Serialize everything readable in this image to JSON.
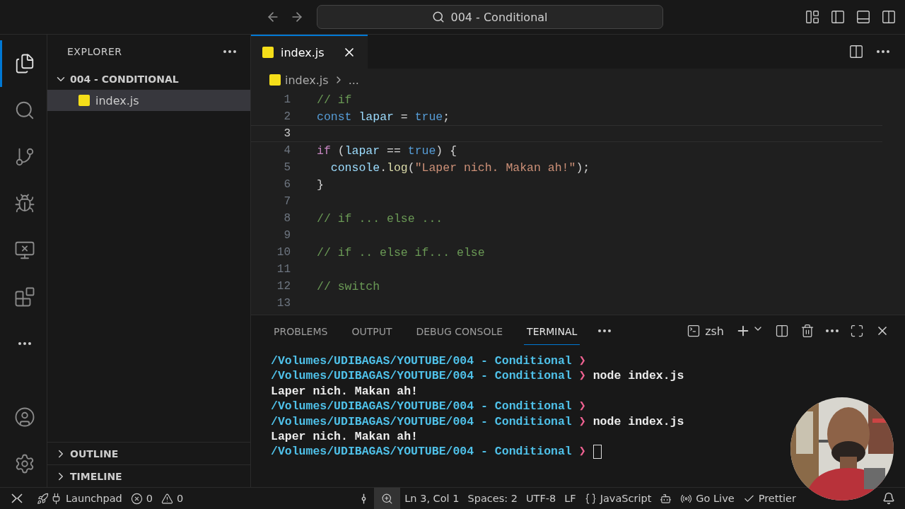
{
  "title_bar": {
    "search": "004 - Conditional"
  },
  "activity_bar": [
    {
      "selected": true
    },
    {
      "selected": false
    },
    {
      "selected": false
    },
    {
      "selected": false
    },
    {
      "selected": false
    },
    {
      "selected": false
    },
    {
      "selected": false
    }
  ],
  "activity_bottom": [
    {
      "selected": false
    },
    {
      "selected": false
    }
  ],
  "sidebar": {
    "title": "EXPLORER",
    "folder": {
      "name": "004 - CONDITIONAL",
      "expanded": true,
      "files": [
        {
          "name": "index.js",
          "selected": true
        }
      ]
    },
    "sections": [
      {
        "name": "OUTLINE",
        "expanded": false
      },
      {
        "name": "TIMELINE",
        "expanded": false
      }
    ]
  },
  "editor": {
    "tabs": [
      {
        "name": "index.js",
        "selected": true
      }
    ],
    "breadcrumb": {
      "file": "index.js",
      "rest": "..."
    },
    "lines": [
      {
        "number": "1",
        "current": false,
        "tokens": [
          {
            "kind": "comment",
            "text": "// if"
          }
        ]
      },
      {
        "number": "2",
        "current": false,
        "tokens": [
          {
            "kind": "keyword",
            "text": "const "
          },
          {
            "kind": "variable",
            "text": "lapar"
          },
          {
            "kind": "punct",
            "text": " = "
          },
          {
            "kind": "keyword",
            "text": "true"
          },
          {
            "kind": "punct",
            "text": ";"
          }
        ]
      },
      {
        "number": "3",
        "current": true
      },
      {
        "number": "4",
        "current": false,
        "tokens": [
          {
            "kind": "control",
            "text": "if "
          },
          {
            "kind": "punct",
            "text": "("
          },
          {
            "kind": "variable",
            "text": "lapar"
          },
          {
            "kind": "punct",
            "text": " == "
          },
          {
            "kind": "keyword",
            "text": "true"
          },
          {
            "kind": "punct",
            "text": ") {"
          }
        ]
      },
      {
        "number": "5",
        "current": false,
        "tokens": [
          {
            "kind": "variable",
            "text": "  console"
          },
          {
            "kind": "punct",
            "text": "."
          },
          {
            "kind": "function",
            "text": "log"
          },
          {
            "kind": "punct",
            "text": "("
          },
          {
            "kind": "string",
            "text": "\"Laper nich. Makan ah!\""
          },
          {
            "kind": "punct",
            "text": ");"
          }
        ]
      },
      {
        "number": "6",
        "current": false,
        "tokens": [
          {
            "kind": "punct",
            "text": "}"
          }
        ]
      },
      {
        "number": "7",
        "current": false
      },
      {
        "number": "8",
        "current": false,
        "tokens": [
          {
            "kind": "comment",
            "text": "// if ... else ..."
          }
        ]
      },
      {
        "number": "9",
        "current": false
      },
      {
        "number": "10",
        "current": false,
        "tokens": [
          {
            "kind": "comment",
            "text": "// if .. else if... else"
          }
        ]
      },
      {
        "number": "11",
        "current": false
      },
      {
        "number": "12",
        "current": false,
        "tokens": [
          {
            "kind": "comment",
            "text": "// switch"
          }
        ]
      },
      {
        "number": "13",
        "current": false
      }
    ]
  },
  "panel": {
    "tabs": [
      {
        "label": "PROBLEMS",
        "selected": false
      },
      {
        "label": "OUTPUT",
        "selected": false
      },
      {
        "label": "DEBUG CONSOLE",
        "selected": false
      },
      {
        "label": "TERMINAL",
        "selected": true
      }
    ],
    "shell": "zsh",
    "lines": [
      {
        "kind": "prompt",
        "path": "/Volumes/UDIBAGAS/YOUTUBE/004 - Conditional",
        "arrow": "❯",
        "cursor": false
      },
      {
        "kind": "prompt",
        "path": "/Volumes/UDIBAGAS/YOUTUBE/004 - Conditional",
        "arrow": "❯",
        "command": "node index.js",
        "cursor": false
      },
      {
        "kind": "output",
        "text": "Laper nich. Makan ah!"
      },
      {
        "kind": "prompt",
        "path": "/Volumes/UDIBAGAS/YOUTUBE/004 - Conditional",
        "arrow": "❯",
        "cursor": false
      },
      {
        "kind": "prompt",
        "path": "/Volumes/UDIBAGAS/YOUTUBE/004 - Conditional",
        "arrow": "❯",
        "command": "node index.js",
        "cursor": false
      },
      {
        "kind": "output",
        "text": "Laper nich. Makan ah!"
      },
      {
        "kind": "prompt",
        "path": "/Volumes/UDIBAGAS/YOUTUBE/004 - Conditional",
        "arrow": "❯",
        "cursor": true
      }
    ]
  },
  "status_bar": {
    "left": [
      {
        "text": "Launchpad"
      },
      {
        "text": "0"
      },
      {
        "text": "0"
      }
    ],
    "zoom": {
      "selected": true
    },
    "right": [
      {
        "text": "Ln 3, Col 1"
      },
      {
        "text": "Spaces: 2"
      },
      {
        "text": "UTF-8"
      },
      {
        "text": "LF"
      },
      {
        "text": "JavaScript"
      },
      {
        "text": "Go Live"
      },
      {
        "text": "Prettier"
      }
    ]
  }
}
